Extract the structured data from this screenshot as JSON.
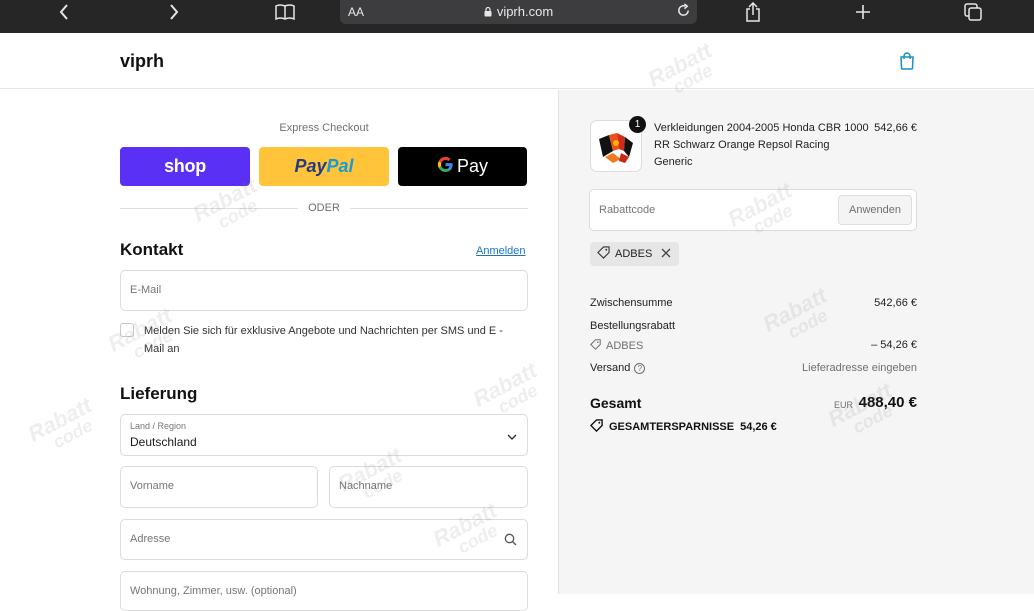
{
  "browser": {
    "text_size_label": "AA",
    "url": "viprh.com"
  },
  "store": {
    "name": "viprh"
  },
  "express": {
    "label": "Express Checkout",
    "shop_label": "shop",
    "paypal_label_1": "Pay",
    "paypal_label_2": "Pal",
    "gpay_label": "Pay",
    "divider": "ODER"
  },
  "contact": {
    "heading": "Kontakt",
    "login_link": "Anmelden",
    "email_placeholder": "E-Mail",
    "marketing_optin": "Melden Sie sich für exklusive Angebote und Nachrichten per SMS und E - Mail an"
  },
  "delivery": {
    "heading": "Lieferung",
    "country_label": "Land / Region",
    "country_value": "Deutschland",
    "first_name_placeholder": "Vorname",
    "last_name_placeholder": "Nachname",
    "address_placeholder": "Adresse",
    "apartment_placeholder": "Wohnung, Zimmer, usw. (optional)"
  },
  "summary": {
    "item": {
      "quantity": "1",
      "name": "Verkleidungen 2004-2005 Honda CBR 1000 RR Schwarz Orange Repsol Racing Generic",
      "price": "542,66 €"
    },
    "discount_placeholder": "Rabattcode",
    "apply_label": "Anwenden",
    "applied_code": "ADBES",
    "subtotal_label": "Zwischensumme",
    "subtotal_value": "542,66 €",
    "order_discount_label": "Bestellungsrabatt",
    "order_discount_code": "ADBES",
    "order_discount_value": "– 54,26 €",
    "shipping_label": "Versand",
    "shipping_value": "Lieferadresse eingeben",
    "total_label": "Gesamt",
    "total_currency": "EUR",
    "total_value": "488,40 €",
    "savings_label": "GESAMTERSPARNISSE",
    "savings_value": "54,26 €"
  },
  "watermark": {
    "line1": "Rabatt",
    "line2": "code"
  }
}
